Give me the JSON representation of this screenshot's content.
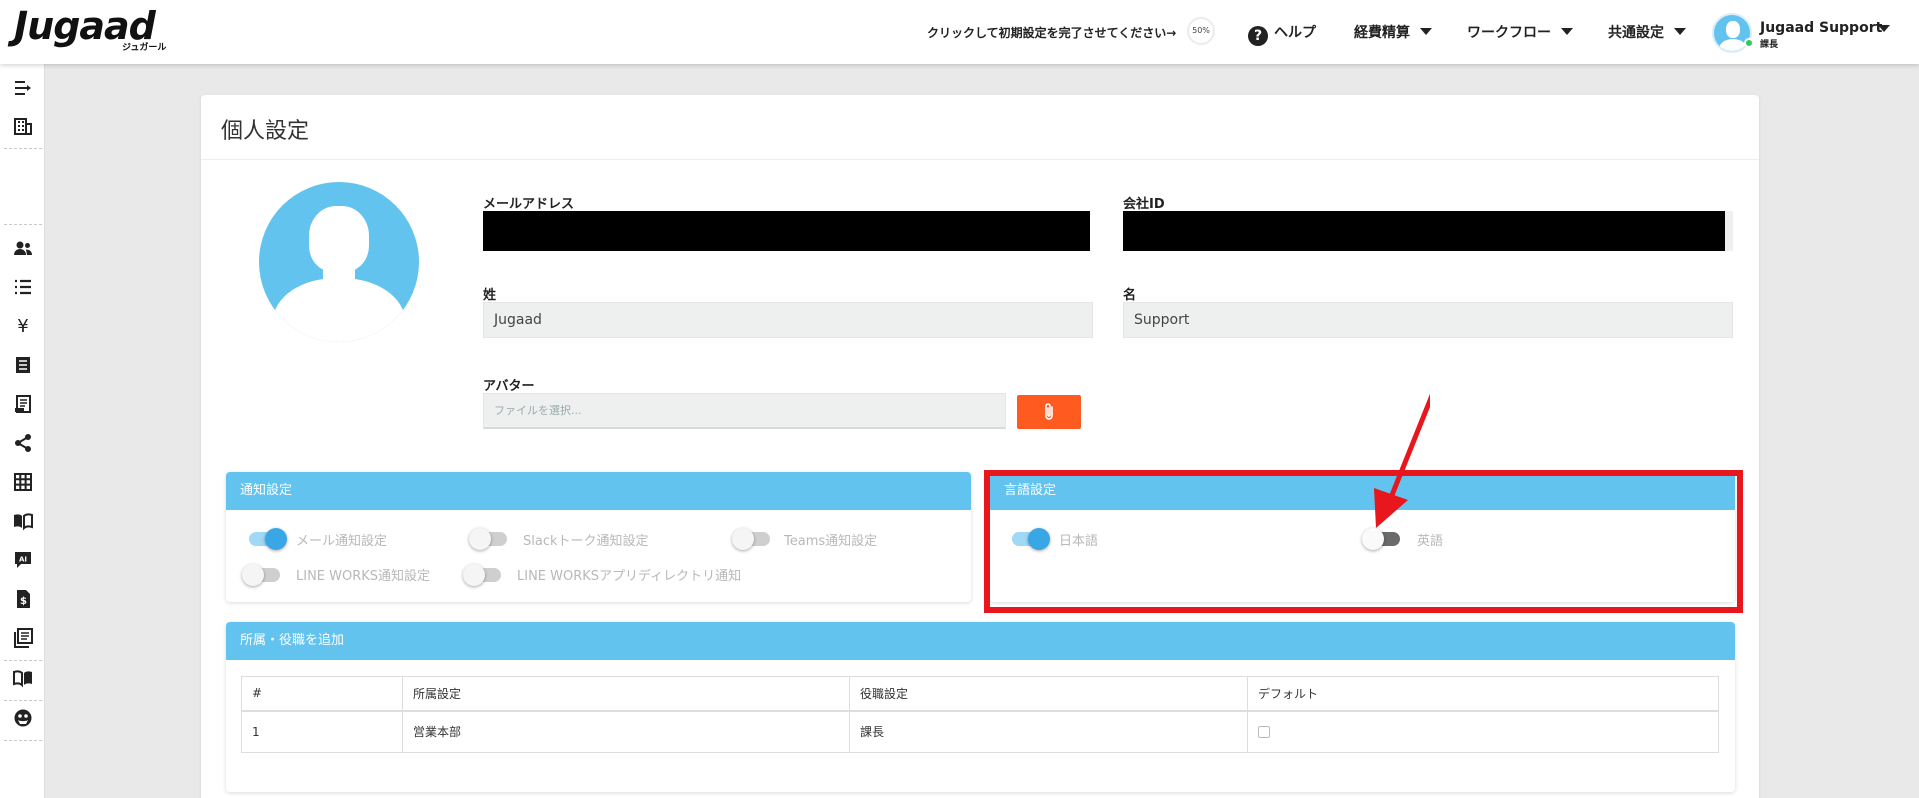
{
  "header": {
    "logo": "Jugaad",
    "logo_sub": "ジュガール",
    "onboarding_text": "クリックして初期設定を完了させてください→",
    "onboarding_progress": "50%",
    "nav": {
      "help": "ヘルプ",
      "expense": "経費精算",
      "workflow": "ワークフロー",
      "common_settings": "共通設定"
    },
    "user": {
      "name": "Jugaad Support",
      "role": "課長"
    }
  },
  "sidebar": {
    "icons": [
      "indent-icon",
      "building-icon",
      "users-icon",
      "list-icon",
      "yen-icon",
      "receipt-icon",
      "invoice-icon",
      "share-icon",
      "grid-icon",
      "book-open-icon",
      "ai-chat-icon",
      "dollar-document-icon",
      "library-icon",
      "manual-icon",
      "support-icon"
    ]
  },
  "page": {
    "title": "個人設定",
    "fields": {
      "email_label": "メールアドレス",
      "company_id_label": "会社ID",
      "last_name_label": "姓",
      "last_name_value": "Jugaad",
      "first_name_label": "名",
      "first_name_value": "Support",
      "avatar_label": "アバター",
      "avatar_placeholder": "ファイルを選択..."
    },
    "notification": {
      "title": "通知設定",
      "options": [
        {
          "label": "メール通知設定",
          "on": true
        },
        {
          "label": "Slackトーク通知設定",
          "on": false
        },
        {
          "label": "Teams通知設定",
          "on": false
        },
        {
          "label": "LINE WORKS通知設定",
          "on": false
        },
        {
          "label": "LINE WORKSアプリディレクトリ通知",
          "on": false
        }
      ]
    },
    "language": {
      "title": "言語設定",
      "options": [
        {
          "label": "日本語",
          "on": true
        },
        {
          "label": "英語",
          "on": false
        }
      ]
    },
    "affiliation": {
      "title": "所属・役職を追加",
      "columns": [
        "#",
        "所属設定",
        "役職設定",
        "デフォルト"
      ],
      "rows": [
        {
          "no": "1",
          "department": "営業本部",
          "position": "課長",
          "default": false
        }
      ]
    }
  },
  "colors": {
    "accent": "#63c3ef",
    "attach_button": "#ff5a1f",
    "highlight": "#e8161d"
  }
}
